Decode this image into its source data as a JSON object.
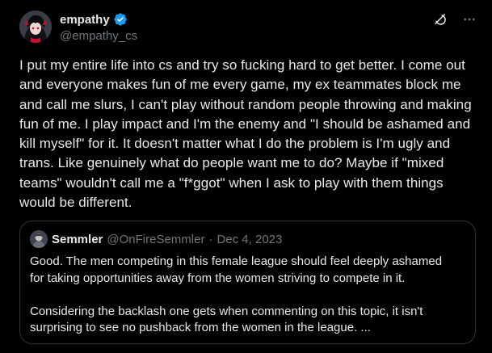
{
  "author": {
    "display_name": "empathy",
    "handle": "@empathy_cs",
    "avatar_icon": "anime-avatar-icon",
    "verified_icon": "verified-badge-icon",
    "verified_color": "#1d9bf0"
  },
  "actions": {
    "grok_icon": "grok-icon",
    "more_icon": "more-options-icon"
  },
  "tweet": {
    "text": "I put my entire life into cs and try so fucking hard to get better. I come out and everyone makes fun of me every game, my ex teammates block me and call me slurs, I can't play without random people throwing and making fun of me. I play impact and I'm the enemy and \"I should be ashamed and kill myself\" for it. It doesn't matter what I do the problem is I'm ugly and trans. Like genuinely what do people want me to do? Maybe if \"mixed teams\" wouldn't call me a \"f*ggot\" when I ask to play with them things would be different."
  },
  "quote": {
    "display_name": "Semmler",
    "handle": "@OnFireSemmler",
    "separator": "·",
    "date": "Dec 4, 2023",
    "avatar_icon": "semmler-avatar-icon",
    "paragraph_1": "Good. The men competing in this female league should feel deeply ashamed for taking opportunities away from the women striving to compete in it.",
    "paragraph_2": "Considering the backlash one gets when commenting on this topic, it isn't surprising to see no pushback from the women in the league. ..."
  },
  "colors": {
    "background": "#000000",
    "text_primary": "#e7e9ea",
    "text_secondary": "#71767b",
    "border": "#2f3336"
  }
}
